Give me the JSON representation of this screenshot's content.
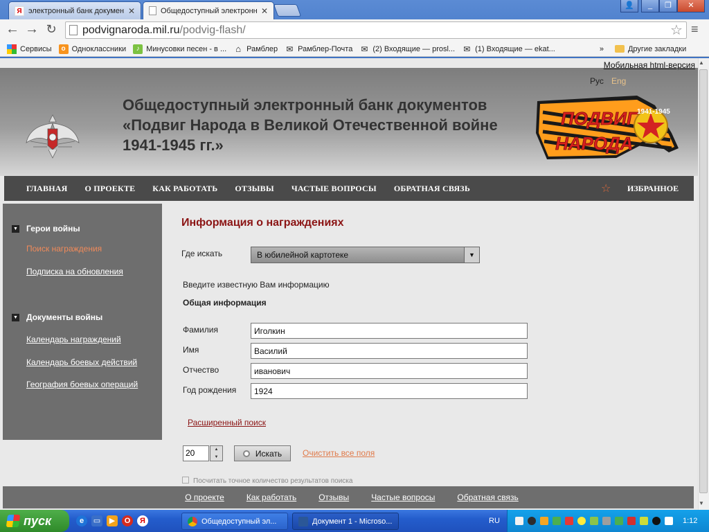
{
  "browser": {
    "tabs": [
      {
        "title": "электронный банк докумен",
        "favicon": "yandex-icon",
        "active": false
      },
      {
        "title": "Общедоступный электронн",
        "favicon": "page-icon",
        "active": true
      }
    ],
    "url_host": "podvignaroda.mil.ru",
    "url_path": "/podvig-flash/",
    "bookmarks": [
      {
        "label": "Сервисы",
        "icon": "apps-grid-icon"
      },
      {
        "label": "Одноклассники",
        "icon": "odnoklassniki-icon"
      },
      {
        "label": "Минусовки песен - в ...",
        "icon": "music-icon"
      },
      {
        "label": "Рамблер",
        "icon": "home-icon"
      },
      {
        "label": "Рамблер-Почта",
        "icon": "mail-icon"
      },
      {
        "label": "(2) Входящие — prosl...",
        "icon": "mail-icon"
      },
      {
        "label": "(1) Входящие — ekat...",
        "icon": "mail-icon"
      }
    ],
    "bookmarks_overflow": "»",
    "other_bookmarks": "Другие закладки"
  },
  "header": {
    "mobile_link": "Мобильная html-версия",
    "title_line1": "Общедоступный электронный банк документов",
    "title_line2": "«Подвиг Народа в Великой Отечественной войне",
    "title_line3": "1941-1945 гг.»",
    "lang_ru": "Рус",
    "lang_en": "Eng",
    "logo_text_top": "ПОДВИГ",
    "logo_text_bottom": "НАРОДА",
    "logo_years": "1941-1945"
  },
  "nav": {
    "items": [
      "ГЛАВНАЯ",
      "О ПРОЕКТЕ",
      "КАК РАБОТАТЬ",
      "ОТЗЫВЫ",
      "ЧАСТЫЕ ВОПРОСЫ",
      "ОБРАТНАЯ СВЯЗЬ"
    ],
    "favorites": "ИЗБРАННОЕ"
  },
  "sidebar": {
    "section1": "Герои войны",
    "section1_items": [
      "Поиск награждения",
      "Подписка на обновления"
    ],
    "section2": "Документы войны",
    "section2_items": [
      "Календарь награждений",
      "Календарь боевых действий",
      "География боевых операций"
    ]
  },
  "form": {
    "title": "Информация о награждениях",
    "where_label": "Где искать",
    "where_value": "В юбилейной картотеке",
    "intro": "Введите известную Вам информацию",
    "general": "Общая информация",
    "surname_label": "Фамилия",
    "surname_value": "Иголкин",
    "name_label": "Имя",
    "name_value": "Василий",
    "patronymic_label": "Отчество",
    "patronymic_value": "иванович",
    "birth_label": "Год рождения",
    "birth_value": "1924",
    "advanced": "Расширенный поиск",
    "count_value": "20",
    "search_button": "Искать",
    "clear_link": "Очистить все поля",
    "exact_count": "Посчитать точное количество результатов поиска"
  },
  "footer": {
    "links": [
      "О проекте",
      "Как работать",
      "Отзывы",
      "Частые вопросы",
      "Обратная связь"
    ]
  },
  "taskbar": {
    "start": "пуск",
    "tasks": [
      {
        "label": "Общедоступный эл...",
        "icon": "chrome-icon"
      },
      {
        "label": "Документ 1 - Microso...",
        "icon": "word-icon"
      }
    ],
    "language": "RU",
    "clock": "1:12"
  },
  "colors": {
    "accent_red": "#8b1414",
    "sidebar_active": "#f08a5a",
    "nav_bg": "#4a4a4a",
    "sidebar_bg": "#6e6e6e"
  }
}
